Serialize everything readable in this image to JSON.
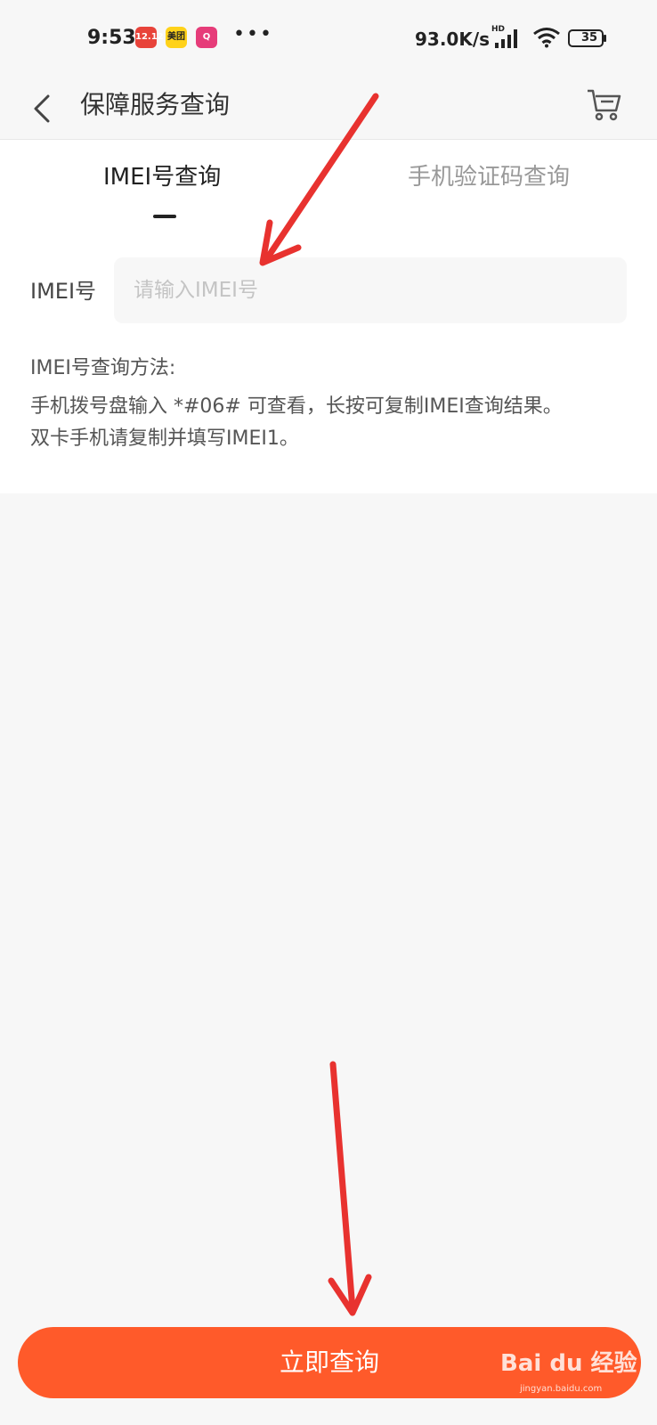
{
  "status_bar": {
    "time": "9:53",
    "app_badges": [
      "12.12",
      "美团",
      "Q"
    ],
    "more_dots": "•••",
    "net_speed": "93.0K/s",
    "hd_label": "HD",
    "battery_level": "35"
  },
  "nav": {
    "title": "保障服务查询",
    "icons": [
      "chevron-left-icon",
      "cart-icon"
    ]
  },
  "tabs": [
    {
      "label": "IMEI号查询",
      "active": true
    },
    {
      "label": "手机验证码查询",
      "active": false
    }
  ],
  "form": {
    "imei_label": "IMEI号",
    "imei_placeholder": "请输入IMEI号",
    "imei_value": "",
    "method_title": "IMEI号查询方法:",
    "method_lines": [
      "手机拨号盘输入 *#06# 可查看，长按可复制IMEI查询结果。",
      "双卡手机请复制并填写IMEI1。"
    ]
  },
  "primary_button": {
    "label": "立即查询"
  },
  "watermark": {
    "brand": "Bai du 经验",
    "url": "jingyan.baidu.com"
  },
  "colors": {
    "accent": "#ff5a2a",
    "annotation_arrow": "#e8322f",
    "background": "#f7f7f7",
    "inactive_tab": "#999999"
  }
}
